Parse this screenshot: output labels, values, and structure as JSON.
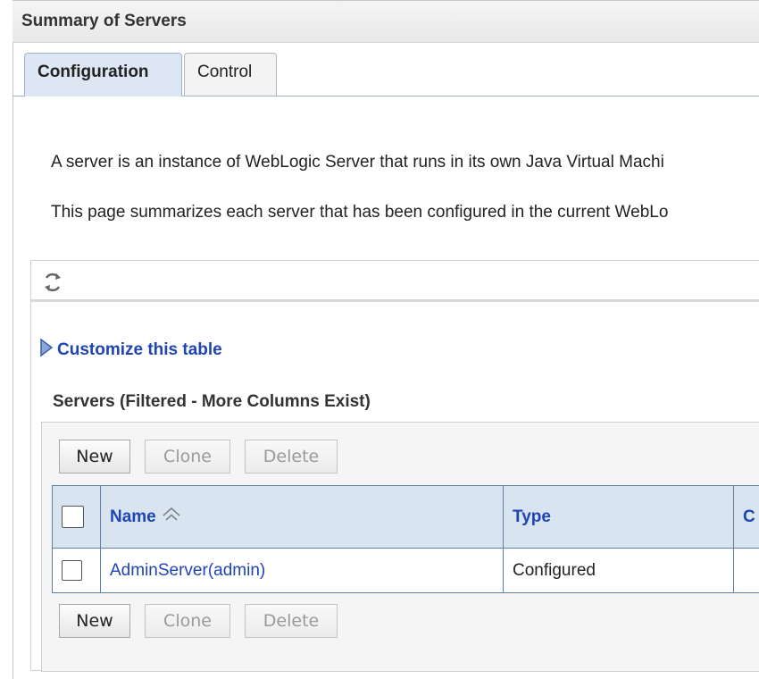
{
  "page": {
    "title": "Summary of Servers",
    "tabs": [
      {
        "label": "Configuration",
        "active": true
      },
      {
        "label": "Control",
        "active": false
      }
    ],
    "description": [
      "A server is an instance of WebLogic Server that runs in its own Java Virtual Machi",
      "This page summarizes each server that has been configured in the current WebLo"
    ]
  },
  "toolbar": {
    "refresh_icon": "refresh-icon"
  },
  "customize": {
    "label": "Customize this table",
    "icon": "expand-triangle-icon"
  },
  "servers_table": {
    "title": "Servers (Filtered - More Columns Exist)",
    "buttons": {
      "new": "New",
      "clone": "Clone",
      "delete": "Delete"
    },
    "columns": [
      "Name",
      "Type",
      "C"
    ],
    "sort_column": "Name",
    "rows": [
      {
        "name": "AdminServer(admin)",
        "type": "Configured",
        "c": ""
      }
    ]
  },
  "colors": {
    "link": "#1f44b3",
    "header_bg": "#d9e4f1",
    "active_tab_bg": "#dce7f3",
    "grid_border": "#5f7ea8"
  }
}
